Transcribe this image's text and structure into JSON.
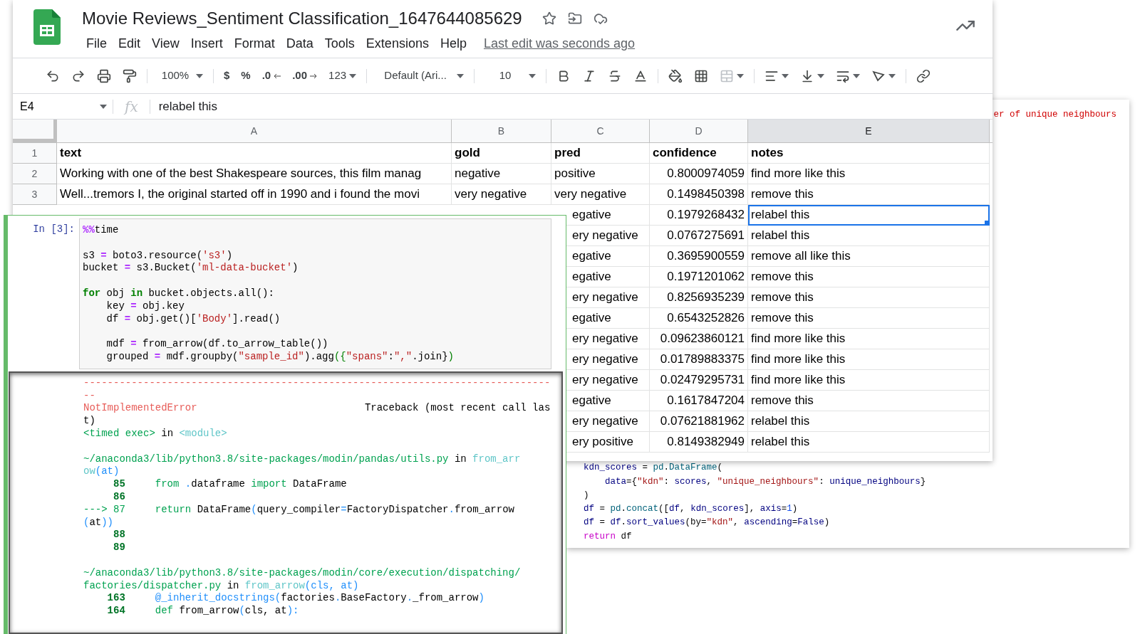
{
  "code_editor": {
    "comment": "er of unique neighbours",
    "lines": [
      [
        {
          "kind": "var",
          "text": "kdn_scores "
        },
        {
          "kind": "plain",
          "text": "= "
        },
        {
          "kind": "func",
          "text": "pd"
        },
        {
          "kind": "plain",
          "text": "."
        },
        {
          "kind": "func",
          "text": "DataFrame"
        },
        {
          "kind": "plain",
          "text": "("
        }
      ],
      [
        {
          "kind": "var",
          "text": "    data"
        },
        {
          "kind": "plain",
          "text": "={"
        },
        {
          "kind": "string",
          "text": "\"kdn\""
        },
        {
          "kind": "plain",
          "text": ": "
        },
        {
          "kind": "var",
          "text": "scores"
        },
        {
          "kind": "plain",
          "text": ", "
        },
        {
          "kind": "string",
          "text": "\"unique_neighbours\""
        },
        {
          "kind": "plain",
          "text": ": "
        },
        {
          "kind": "var",
          "text": "unique_neighbours"
        },
        {
          "kind": "plain",
          "text": "}"
        }
      ],
      [
        {
          "kind": "plain",
          "text": ")"
        }
      ],
      [
        {
          "kind": "var",
          "text": "df "
        },
        {
          "kind": "plain",
          "text": "= "
        },
        {
          "kind": "func",
          "text": "pd"
        },
        {
          "kind": "plain",
          "text": "."
        },
        {
          "kind": "func",
          "text": "concat"
        },
        {
          "kind": "plain",
          "text": "(["
        },
        {
          "kind": "var",
          "text": "df"
        },
        {
          "kind": "plain",
          "text": ", "
        },
        {
          "kind": "var",
          "text": "kdn_scores"
        },
        {
          "kind": "plain",
          "text": "], "
        },
        {
          "kind": "var",
          "text": "axis"
        },
        {
          "kind": "plain",
          "text": "="
        },
        {
          "kind": "number",
          "text": "1"
        },
        {
          "kind": "plain",
          "text": ")"
        }
      ],
      [
        {
          "kind": "var",
          "text": "df "
        },
        {
          "kind": "plain",
          "text": "= "
        },
        {
          "kind": "var",
          "text": "df"
        },
        {
          "kind": "plain",
          "text": "."
        },
        {
          "kind": "var",
          "text": "sort_values"
        },
        {
          "kind": "plain",
          "text": "(by="
        },
        {
          "kind": "string",
          "text": "\"kdn\""
        },
        {
          "kind": "plain",
          "text": ", "
        },
        {
          "kind": "var",
          "text": "ascending"
        },
        {
          "kind": "plain",
          "text": "="
        },
        {
          "kind": "var",
          "text": "False"
        },
        {
          "kind": "plain",
          "text": ")"
        }
      ],
      [
        {
          "kind": "keyword",
          "text": "return"
        },
        {
          "kind": "plain",
          "text": " df"
        }
      ]
    ]
  },
  "sheet": {
    "title": "Movie Reviews_Sentiment Classification_1647644085629",
    "menu": [
      "File",
      "Edit",
      "View",
      "Insert",
      "Format",
      "Data",
      "Tools",
      "Extensions",
      "Help"
    ],
    "last_edit": "Last edit was seconds ago",
    "toolbar": {
      "zoom": "100%",
      "currency": "$",
      "percent": "%",
      "decimal_less": ".0",
      "decimal_more": ".00",
      "number_format": "123",
      "font": "Default (Ari...",
      "font_size": "10"
    },
    "name_box": "E4",
    "formula_label": "fx",
    "formula": "relabel this",
    "columns": [
      {
        "label": "A",
        "selected": false
      },
      {
        "label": "B",
        "selected": false
      },
      {
        "label": "C",
        "selected": false
      },
      {
        "label": "D",
        "selected": false
      },
      {
        "label": "E",
        "selected": true
      }
    ],
    "rows": [
      {
        "kind": "header",
        "number": "1",
        "text": "text",
        "gold": "gold",
        "pred": "pred",
        "confidence": "confidence",
        "notes": "notes",
        "selected": false
      },
      {
        "kind": "data",
        "number": "2",
        "text": "Working with one of the best Shakespeare sources, this film manag",
        "gold": "negative",
        "pred": "positive",
        "confidence": "0.8000974059",
        "notes": "find more like this",
        "selected": false
      },
      {
        "kind": "data",
        "number": "3",
        "text": "Well...tremors I, the original started off in 1990 and i found the movi",
        "gold": "very negative",
        "pred": "very negative",
        "confidence": "0.1498450398",
        "notes": "remove this",
        "selected": false
      },
      {
        "kind": "covered",
        "pred": "egative",
        "confidence": "0.1979268432",
        "notes": "relabel this",
        "selected": true
      },
      {
        "kind": "covered",
        "pred": "ery negative",
        "confidence": "0.0767275691",
        "notes": "relabel this",
        "selected": false
      },
      {
        "kind": "covered",
        "pred": "egative",
        "confidence": "0.3695900559",
        "notes": "remove all like this",
        "selected": false
      },
      {
        "kind": "covered",
        "pred": "egative",
        "confidence": "0.1971201062",
        "notes": "remove this",
        "selected": false
      },
      {
        "kind": "covered",
        "pred": "ery negative",
        "confidence": "0.8256935239",
        "notes": "remove this",
        "selected": false
      },
      {
        "kind": "covered",
        "pred": "egative",
        "confidence": "0.6543252826",
        "notes": "remove this",
        "selected": false
      },
      {
        "kind": "covered",
        "pred": "ery negative",
        "confidence": "0.09623860121",
        "notes": "find more like this",
        "selected": false
      },
      {
        "kind": "covered",
        "pred": "ery negative",
        "confidence": "0.01789883375",
        "notes": "find more like this",
        "selected": false
      },
      {
        "kind": "covered",
        "pred": "ery negative",
        "confidence": "0.02479295731",
        "notes": "find more like this",
        "selected": false
      },
      {
        "kind": "covered",
        "pred": "egative",
        "confidence": "0.1617847204",
        "notes": "remove this",
        "selected": false
      },
      {
        "kind": "covered",
        "pred": "ery negative",
        "confidence": "0.07621881962",
        "notes": "relabel this",
        "selected": false
      },
      {
        "kind": "covered",
        "pred": "ery positive",
        "confidence": "0.8149382949",
        "notes": "relabel this",
        "selected": false
      }
    ]
  },
  "notebook": {
    "prompt": "In [3]:",
    "input_blocks": [
      [
        [
          {
            "kind": "magic",
            "text": "%%"
          },
          {
            "kind": "plain",
            "text": "time"
          }
        ]
      ],
      [
        [
          {
            "kind": "plain",
            "text": "s3 "
          },
          {
            "kind": "operator",
            "text": "="
          },
          {
            "kind": "plain",
            "text": " boto3.resource("
          },
          {
            "kind": "string",
            "text": "'s3'"
          },
          {
            "kind": "plain",
            "text": ")"
          }
        ],
        [
          {
            "kind": "plain",
            "text": "bucket "
          },
          {
            "kind": "operator",
            "text": "="
          },
          {
            "kind": "plain",
            "text": " s3.Bucket("
          },
          {
            "kind": "string",
            "text": "'ml-data-bucket'"
          },
          {
            "kind": "plain",
            "text": ")"
          }
        ]
      ],
      [
        [
          {
            "kind": "keyword",
            "text": "for"
          },
          {
            "kind": "plain",
            "text": " obj "
          },
          {
            "kind": "keyword",
            "text": "in"
          },
          {
            "kind": "plain",
            "text": " bucket.objects.all():"
          }
        ],
        [
          {
            "kind": "plain",
            "text": "    key "
          },
          {
            "kind": "operator",
            "text": "="
          },
          {
            "kind": "plain",
            "text": " obj.key"
          }
        ],
        [
          {
            "kind": "plain",
            "text": "    df "
          },
          {
            "kind": "operator",
            "text": "="
          },
          {
            "kind": "plain",
            "text": " obj.get()["
          },
          {
            "kind": "string",
            "text": "'Body'"
          },
          {
            "kind": "plain",
            "text": "].read()"
          }
        ]
      ],
      [
        [
          {
            "kind": "plain",
            "text": "    mdf "
          },
          {
            "kind": "operator",
            "text": "="
          },
          {
            "kind": "plain",
            "text": " from_arrow(df.to_arrow_table())"
          }
        ],
        [
          {
            "kind": "plain",
            "text": "    grouped "
          },
          {
            "kind": "operator",
            "text": "="
          },
          {
            "kind": "plain",
            "text": " mdf.groupby("
          },
          {
            "kind": "string",
            "text": "\"sample_id\""
          },
          {
            "kind": "plain",
            "text": ").agg"
          },
          {
            "kind": "bracket",
            "text": "({"
          },
          {
            "kind": "string",
            "text": "\"spans\""
          },
          {
            "kind": "plain",
            "text": ":"
          },
          {
            "kind": "string",
            "text": "\",\""
          },
          {
            "kind": "plain",
            "text": ".join}"
          },
          {
            "kind": "bracket",
            "text": ")"
          }
        ]
      ]
    ],
    "output_blocks": [
      [
        [
          {
            "kind": "error",
            "text": "------------------------------------------------------------------------------"
          }
        ],
        [
          {
            "kind": "error",
            "text": "--"
          }
        ],
        [
          {
            "kind": "error",
            "text": "NotImplementedError"
          },
          {
            "kind": "plain",
            "text": "                            Traceback (most recent call las"
          }
        ],
        [
          {
            "kind": "plain",
            "text": "t)"
          }
        ],
        [
          {
            "kind": "path",
            "text": "<timed exec>"
          },
          {
            "kind": "plain",
            "text": " in "
          },
          {
            "kind": "function",
            "text": "<module>"
          }
        ]
      ],
      [
        [
          {
            "kind": "path",
            "text": "~/anaconda3/lib/python3.8/site-packages/modin/pandas/utils.py"
          },
          {
            "kind": "plain",
            "text": " in "
          },
          {
            "kind": "function",
            "text": "from_arr"
          }
        ],
        [
          {
            "kind": "function",
            "text": "ow"
          },
          {
            "kind": "paren",
            "text": "(at)"
          }
        ],
        [
          {
            "kind": "lineno",
            "text": "     85"
          },
          {
            "kind": "path",
            "text": "     from"
          },
          {
            "kind": "paren",
            "text": " ."
          },
          {
            "kind": "plain",
            "text": "dataframe "
          },
          {
            "kind": "path",
            "text": "import"
          },
          {
            "kind": "plain",
            "text": " DataFrame"
          }
        ],
        [
          {
            "kind": "lineno",
            "text": "     86"
          }
        ],
        [
          {
            "kind": "path",
            "text": "---> 87"
          },
          {
            "kind": "path",
            "text": "     return"
          },
          {
            "kind": "plain",
            "text": " DataFrame"
          },
          {
            "kind": "paren",
            "text": "("
          },
          {
            "kind": "plain",
            "text": "query_compiler"
          },
          {
            "kind": "paren",
            "text": "="
          },
          {
            "kind": "plain",
            "text": "FactoryDispatcher"
          },
          {
            "kind": "paren",
            "text": "."
          },
          {
            "kind": "plain",
            "text": "from_arrow"
          }
        ],
        [
          {
            "kind": "paren",
            "text": "("
          },
          {
            "kind": "plain",
            "text": "at"
          },
          {
            "kind": "paren",
            "text": "))"
          }
        ],
        [
          {
            "kind": "lineno",
            "text": "     88"
          }
        ],
        [
          {
            "kind": "lineno",
            "text": "     89"
          }
        ]
      ],
      [
        [
          {
            "kind": "path",
            "text": "~/anaconda3/lib/python3.8/site-packages/modin/core/execution/dispatching/"
          }
        ],
        [
          {
            "kind": "path",
            "text": "factories/dispatcher.py"
          },
          {
            "kind": "plain",
            "text": " in "
          },
          {
            "kind": "function",
            "text": "from_arrow"
          },
          {
            "kind": "paren",
            "text": "(cls, at)"
          }
        ],
        [
          {
            "kind": "lineno",
            "text": "    163"
          },
          {
            "kind": "paren",
            "text": "     @_inherit_docstrings("
          },
          {
            "kind": "plain",
            "text": "factories"
          },
          {
            "kind": "paren",
            "text": "."
          },
          {
            "kind": "plain",
            "text": "BaseFactory"
          },
          {
            "kind": "paren",
            "text": "."
          },
          {
            "kind": "plain",
            "text": "_from_arrow"
          },
          {
            "kind": "paren",
            "text": ")"
          }
        ],
        [
          {
            "kind": "lineno",
            "text": "    164"
          },
          {
            "kind": "path",
            "text": "     def"
          },
          {
            "kind": "plain",
            "text": " from_arrow"
          },
          {
            "kind": "paren",
            "text": "("
          },
          {
            "kind": "plain",
            "text": "cls, at"
          },
          {
            "kind": "paren",
            "text": "):"
          }
        ]
      ]
    ]
  }
}
